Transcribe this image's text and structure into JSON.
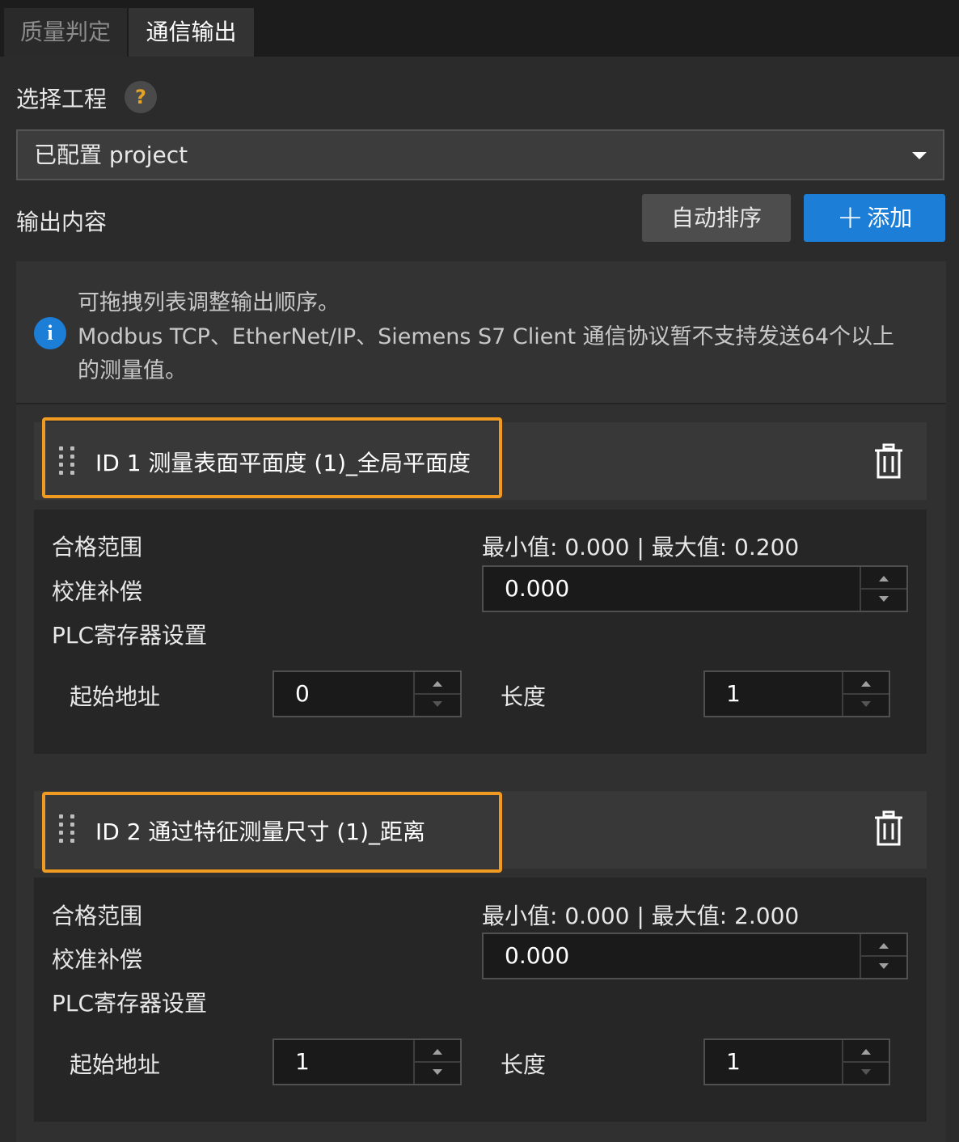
{
  "tabs": [
    {
      "label": "质量判定",
      "active": false
    },
    {
      "label": "通信输出",
      "active": true
    }
  ],
  "project": {
    "label": "选择工程",
    "help": "?",
    "selected": "已配置 project"
  },
  "output": {
    "label": "输出内容",
    "sort_button": "自动排序",
    "add_button": "添加",
    "add_plus": "+"
  },
  "info": {
    "icon": "i",
    "lines": [
      "可拖拽列表调整输出顺序。",
      "Modbus TCP、EtherNet/IP、Siemens S7 Client 通信协议暂不支持发送64个以上",
      "的测量值。"
    ]
  },
  "items": [
    {
      "title": "ID 1  测量表面平面度 (1)_全局平面度",
      "range_label": "合格范围",
      "range_value": "最小值: 0.000 | 最大值: 0.200",
      "calib_label": "校准补偿",
      "calib_value": "0.000",
      "plc_label": "PLC寄存器设置",
      "start_label": "起始地址",
      "start_value": "0",
      "length_label": "长度",
      "length_value": "1"
    },
    {
      "title": "ID 2  通过特征测量尺寸 (1)_距离",
      "range_label": "合格范围",
      "range_value": "最小值: 0.000 | 最大值: 2.000",
      "calib_label": "校准补偿",
      "calib_value": "0.000",
      "plc_label": "PLC寄存器设置",
      "start_label": "起始地址",
      "start_value": "1",
      "length_label": "长度",
      "length_value": "1"
    }
  ],
  "colors": {
    "accent": "#1c7ed6",
    "highlight": "#f19a22",
    "help": "#e4a324"
  }
}
